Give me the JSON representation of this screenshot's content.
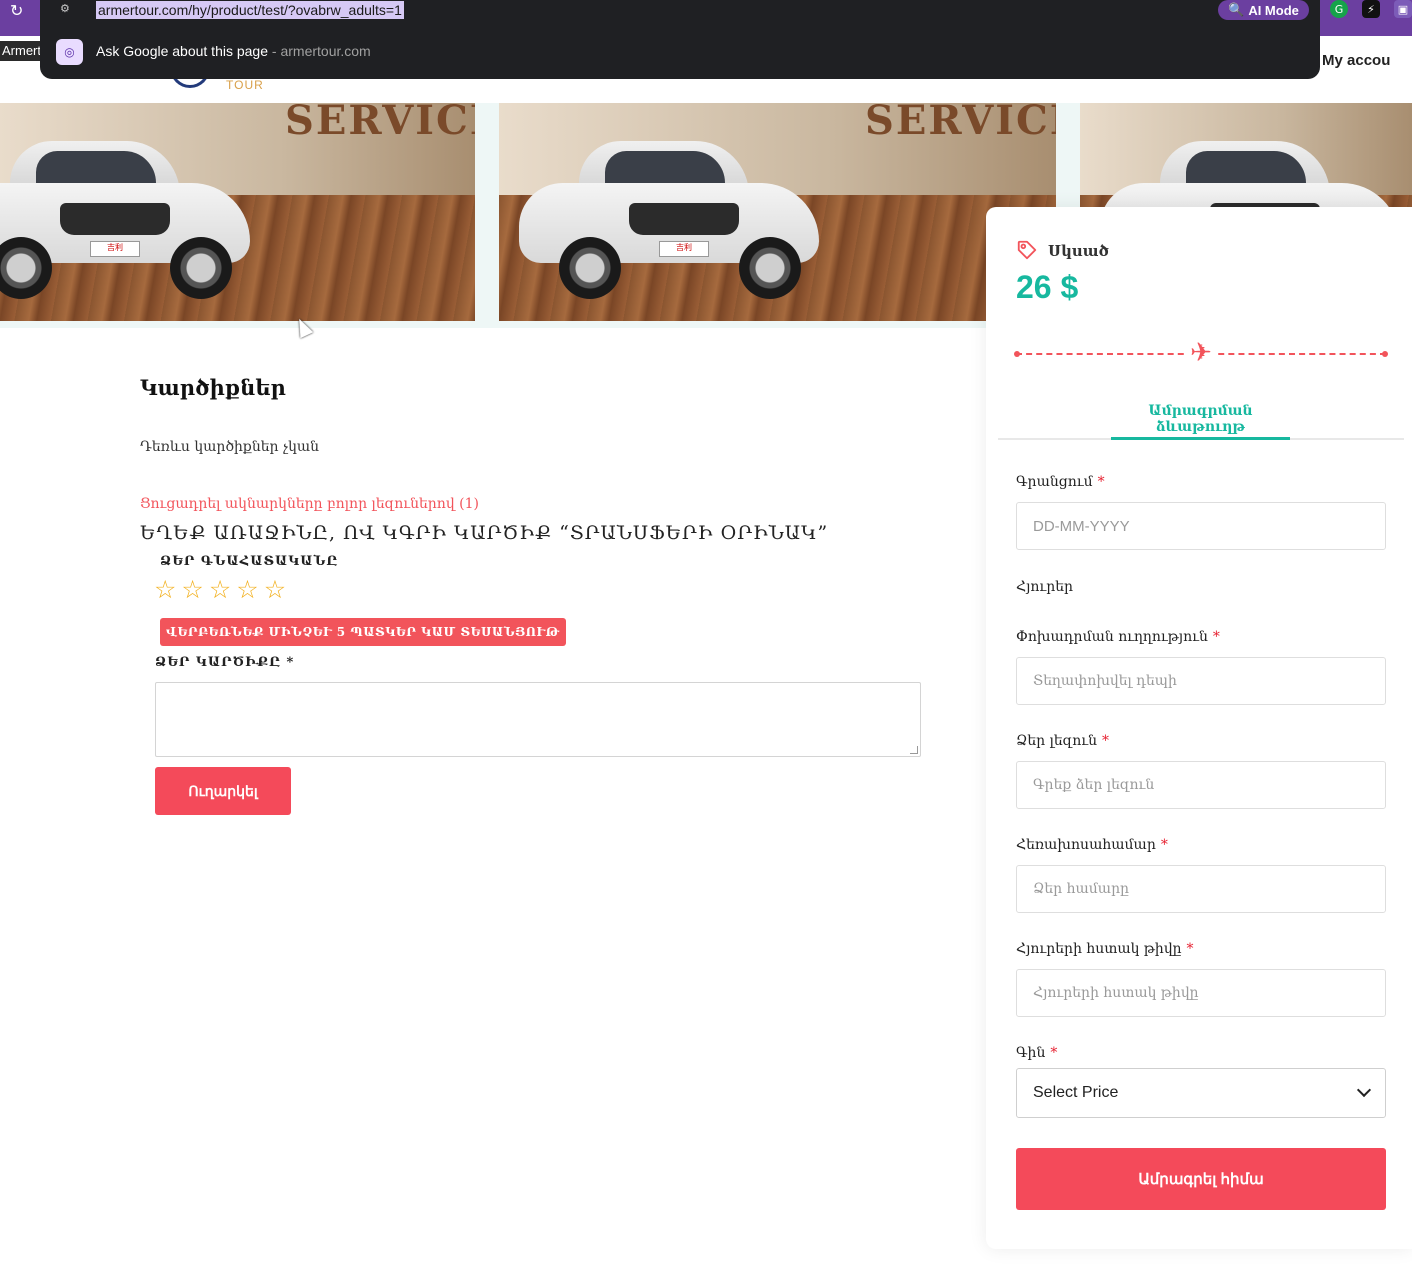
{
  "browser": {
    "url": "armertour.com/hy/product/test/?ovabrw_adults=1",
    "ai_mode_label": "AI Mode",
    "suggestion": "Ask Google about this page",
    "suggestion_domain": "armertour.com",
    "tab_title_fragment": "Armerto",
    "account_fragment": "My accou"
  },
  "header": {
    "logo_text": "TOUR"
  },
  "gallery": {
    "banner_word": "SERVICI",
    "plate_text": "吉利"
  },
  "reviews": {
    "title": "Կարծիքներ",
    "empty_text": "Դեռևս կարծիքներ չկան",
    "show_all_link": "Ցուցադրել ակնարկները բոլոր լեզուներով (1)",
    "be_first": "ԵՂԵՔ ԱՌԱՋԻՆԸ, ՈՎ ԿԳՐԻ ԿԱՐԾԻՔ “ՏՐԱՆՍՖԵՐԻ ՕՐԻՆԱԿ”",
    "rating_label": "ՁԵՐ ԳՆԱՀԱՏԱԿԱՆԸ",
    "rating_value": 0,
    "rating_max": 5,
    "upload_badge": "ՎԵՐԲԵՌՆԵՔ ՄԻՆՉԵՒ 5 ՊԱՏԿԵՐ ԿԱՄ ՏԵՍԱՆՅՈՒԹ",
    "comment_label": "ՁԵՐ ԿԱՐԾԻՔԸ *",
    "submit_label": "Ուղարկել"
  },
  "booking": {
    "from_label": "Սկսած",
    "price": "26 $",
    "tab_label": "Ամրագրման ձևաթուղթ",
    "fields": {
      "checkin_label": "Գրանցում",
      "checkin_placeholder": "DD-MM-YYYY",
      "guests_label": "Հյուրեր",
      "direction_label": "Փոխադրման ուղղություն",
      "direction_placeholder": "Տեղափոխվել դեպի",
      "language_label": "Ձեր լեզուն",
      "language_placeholder": "Գրեք ձեր լեզուն",
      "phone_label": "Հեռախոսահամար",
      "phone_placeholder": "Ձեր համարը",
      "guest_count_label": "Հյուրերի հստակ թիվը",
      "guest_count_placeholder": "Հյուրերի հստակ թիվը",
      "price_label": "Գին",
      "price_select_value": "Select Price",
      "required_mark": "*"
    },
    "book_now_label": "Ամրագրել հիմա"
  },
  "colors": {
    "accent_teal": "#17b89f",
    "accent_red": "#f44a5a",
    "chrome_purple": "#6b3fa0"
  }
}
